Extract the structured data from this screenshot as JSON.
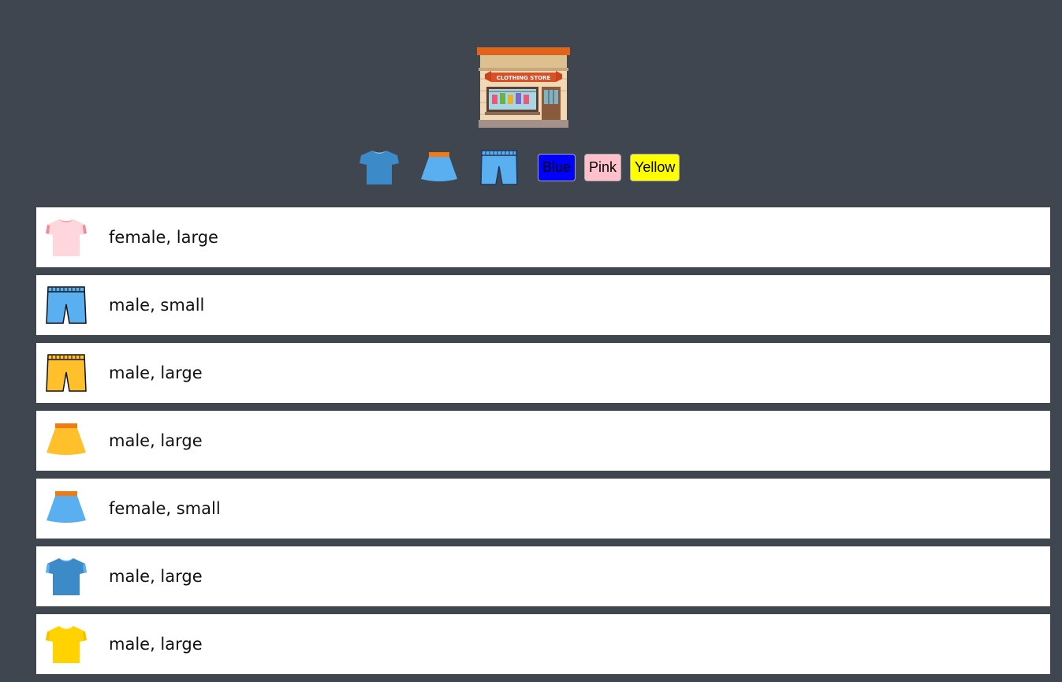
{
  "store": {
    "sign_text": "CLOTHING STORE"
  },
  "filters": {
    "types": [
      {
        "name": "t-shirt",
        "icon": "tshirt-icon"
      },
      {
        "name": "skirt",
        "icon": "skirt-icon"
      },
      {
        "name": "shorts",
        "icon": "shorts-icon"
      }
    ],
    "colors": [
      {
        "label": "Blue",
        "color": "#0000ff"
      },
      {
        "label": "Pink",
        "color": "#ffc0cb"
      },
      {
        "label": "Yellow",
        "color": "#ffff00"
      }
    ]
  },
  "items": [
    {
      "type": "t-shirt",
      "color": "#ffd6dc",
      "label": "female, large"
    },
    {
      "type": "shorts",
      "color": "#5aaff0",
      "label": "male, small"
    },
    {
      "type": "shorts",
      "color": "#ffc02b",
      "label": "male, large"
    },
    {
      "type": "skirt",
      "color": "#ffc02b",
      "label": "male, large"
    },
    {
      "type": "skirt",
      "color": "#5aaff0",
      "label": "female, small"
    },
    {
      "type": "t-shirt",
      "color": "#3d8ac9",
      "label": "male, large"
    },
    {
      "type": "t-shirt",
      "color": "#ffd200",
      "label": "male, large"
    }
  ]
}
